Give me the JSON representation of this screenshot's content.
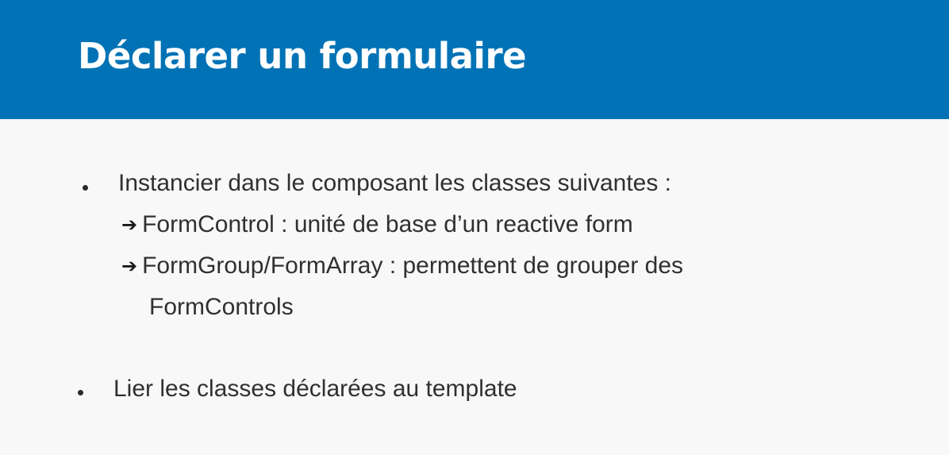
{
  "slide": {
    "title": "Déclarer un formulaire",
    "colors": {
      "header_background": "#0072b5",
      "title_text": "#ffffff",
      "body_text": "#303030",
      "background": "#f8f8f8"
    },
    "bullets": [
      {
        "text": "Instancier dans le composant les classes suivantes :",
        "sub_items": [
          {
            "icon": "right-arrow-icon",
            "text": "FormControl : unité de base d’un reactive form"
          },
          {
            "icon": "right-arrow-icon",
            "text": "FormGroup/FormArray : permettent de grouper des",
            "continuation": "FormControls"
          }
        ]
      },
      {
        "text": "Lier les classes déclarées au template"
      }
    ]
  }
}
